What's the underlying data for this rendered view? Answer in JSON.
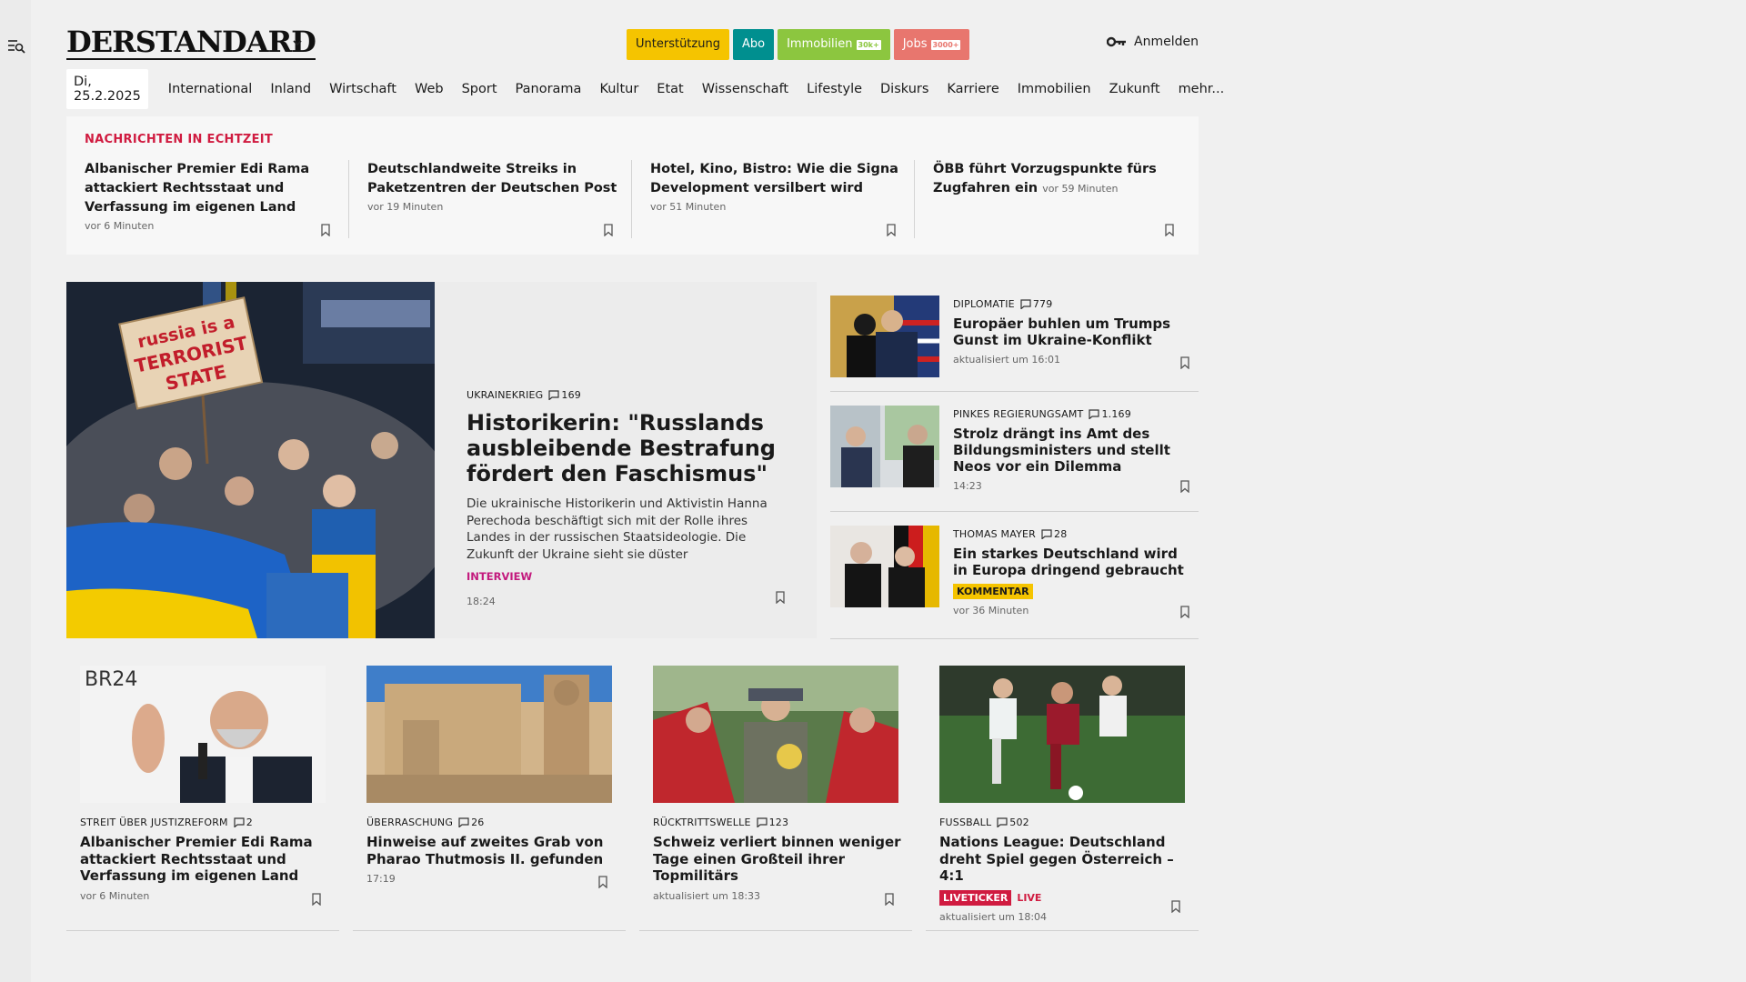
{
  "header": {
    "logo": "DERSTANDARD",
    "pills": [
      {
        "label": "Unterstützung",
        "bg": "#f5c400",
        "color": "#1a1a1a",
        "tag": ""
      },
      {
        "label": "Abo",
        "bg": "#008f8f",
        "color": "#ffffff",
        "tag": ""
      },
      {
        "label": "Immobilien",
        "bg": "#8cc63f",
        "color": "#ffffff",
        "tag": "30k+"
      },
      {
        "label": "Jobs",
        "bg": "#e8766e",
        "color": "#ffffff",
        "tag": "3000+"
      }
    ],
    "login": "Anmelden"
  },
  "nav": {
    "date": "Di, 25.2.2025",
    "items": [
      "International",
      "Inland",
      "Wirtschaft",
      "Web",
      "Sport",
      "Panorama",
      "Kultur",
      "Etat",
      "Wissenschaft",
      "Lifestyle",
      "Diskurs",
      "Karriere",
      "Immobilien",
      "Zukunft",
      "mehr..."
    ]
  },
  "ticker": {
    "title": "NACHRICHTEN IN ECHTZEIT",
    "items": [
      {
        "headline": "Albanischer Premier Edi Rama attackiert Rechtsstaat und Verfassung im eigenen Land",
        "time": "vor 6 Minuten"
      },
      {
        "headline": "Deutschlandweite Streiks in Paketzentren der Deutschen Post",
        "time": "vor 19 Minuten"
      },
      {
        "headline": "Hotel, Kino, Bistro: Wie die Signa Development versilbert wird",
        "time": "vor 51 Minuten"
      },
      {
        "headline": "ÖBB führt Vorzugspunkte fürs Zugfahren ein",
        "time": "vor 59 Minuten"
      }
    ]
  },
  "hero": {
    "kicker": "UKRAINEKRIEG",
    "comments": "169",
    "title": "Historikerin: \"Russlands ausbleibende Bestrafung fördert den Faschismus\"",
    "lead": "Die ukrainische Historikerin und Aktivistin Hanna Perechoda beschäftigt sich mit der Rolle ihres Landes in der russischen Staatsideologie. Die Zukunft der Ukraine sieht sie düster",
    "badge": "INTERVIEW",
    "time": "18:24",
    "sign_text": "russia is a TERRORIST STATE"
  },
  "side": [
    {
      "kicker": "DIPLOMATIE",
      "comments": "779",
      "title": "Europäer buhlen um Trumps Gunst im Ukraine-Konflikt",
      "meta": "aktualisiert um 16:01",
      "badge": ""
    },
    {
      "kicker": "PINKES REGIERUNGSAMT",
      "comments": "1.169",
      "title": "Strolz drängt ins Amt des Bildungsministers und stellt Neos vor ein Dilemma",
      "meta": "14:23",
      "badge": ""
    },
    {
      "kicker": "THOMAS MAYER",
      "comments": "28",
      "title": "Ein starkes Deutschland wird in Europa dringend gebraucht",
      "meta": "vor 36 Minuten",
      "badge": "KOMMENTAR"
    }
  ],
  "cards": [
    {
      "kicker": "STREIT ÜBER JUSTIZREFORM",
      "comments": "2",
      "title": "Albanischer Premier Edi Rama attackiert Rechtsstaat und Verfassung im eigenen Land",
      "meta": "vor 6 Minuten",
      "live": false,
      "img_text": "BR24"
    },
    {
      "kicker": "ÜBERRASCHUNG",
      "comments": "26",
      "title": "Hinweise auf zweites Grab von Pharao Thutmosis II. gefunden",
      "meta": "17:19",
      "live": false,
      "img_text": ""
    },
    {
      "kicker": "RÜCKTRITTSWELLE",
      "comments": "123",
      "title": "Schweiz verliert binnen weniger Tage einen Großteil ihrer Topmilitärs",
      "meta": "aktualisiert um 18:33",
      "live": false,
      "img_text": ""
    },
    {
      "kicker": "FUSSBALL",
      "comments": "502",
      "title": "Nations League: Deutschland dreht Spiel gegen Österreich – 4:1",
      "meta": "aktualisiert um 18:04",
      "live": true,
      "live_label": "LIVETICKER",
      "live_text": "LIVE",
      "img_text": ""
    }
  ]
}
